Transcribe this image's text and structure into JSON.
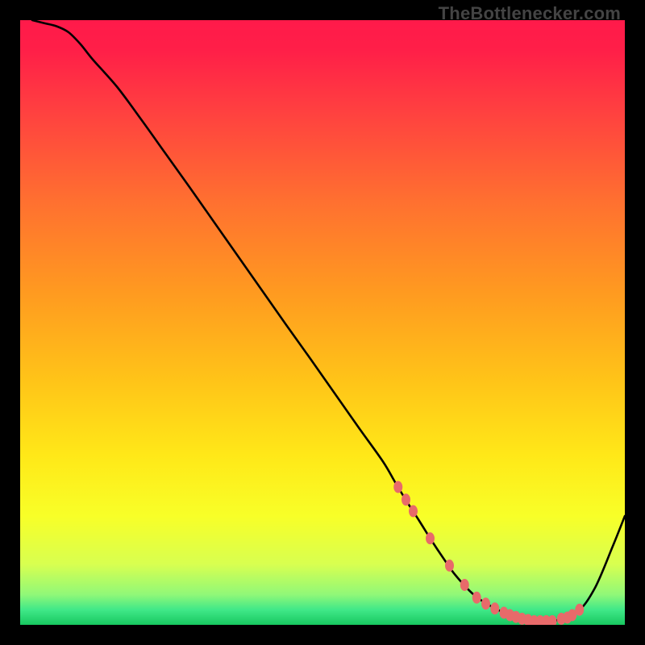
{
  "attribution": "TheBottlenecker.com",
  "chart_data": {
    "type": "line",
    "title": "",
    "xlabel": "",
    "ylabel": "",
    "xlim": [
      0,
      100
    ],
    "ylim": [
      0,
      100
    ],
    "background_gradient": {
      "stops": [
        {
          "offset": 0.0,
          "color": "#ff1a4a"
        },
        {
          "offset": 0.05,
          "color": "#ff1f48"
        },
        {
          "offset": 0.15,
          "color": "#ff4040"
        },
        {
          "offset": 0.3,
          "color": "#ff7030"
        },
        {
          "offset": 0.45,
          "color": "#ff9a20"
        },
        {
          "offset": 0.6,
          "color": "#ffc518"
        },
        {
          "offset": 0.72,
          "color": "#ffe818"
        },
        {
          "offset": 0.82,
          "color": "#f8ff28"
        },
        {
          "offset": 0.9,
          "color": "#d8ff50"
        },
        {
          "offset": 0.95,
          "color": "#90f878"
        },
        {
          "offset": 0.975,
          "color": "#40e888"
        },
        {
          "offset": 1.0,
          "color": "#18c860"
        }
      ]
    },
    "series": [
      {
        "name": "bottleneck-curve",
        "x": [
          2,
          4,
          6,
          8,
          10,
          12,
          16,
          20,
          24,
          28,
          32,
          36,
          40,
          44,
          48,
          52,
          56,
          60,
          62,
          64,
          66,
          68,
          70,
          72,
          75,
          78,
          82,
          85,
          88,
          92,
          95,
          98,
          100
        ],
        "y": [
          100,
          99.5,
          99,
          98,
          96,
          93.5,
          89,
          83.6,
          78,
          72.4,
          66.7,
          61,
          55.3,
          49.6,
          44,
          38.3,
          32.6,
          27,
          23.6,
          20.3,
          17.2,
          14,
          11,
          8.2,
          5,
          3.0,
          1.2,
          0.6,
          0.6,
          2.0,
          6.0,
          13.0,
          18.0
        ]
      }
    ],
    "markers": {
      "name": "highlight-dots",
      "color": "#e86a6a",
      "points": [
        {
          "x": 62.5,
          "y": 22.8
        },
        {
          "x": 63.8,
          "y": 20.7
        },
        {
          "x": 65.0,
          "y": 18.8
        },
        {
          "x": 67.8,
          "y": 14.3
        },
        {
          "x": 71.0,
          "y": 9.8
        },
        {
          "x": 73.5,
          "y": 6.6
        },
        {
          "x": 75.5,
          "y": 4.5
        },
        {
          "x": 77.0,
          "y": 3.5
        },
        {
          "x": 78.5,
          "y": 2.7
        },
        {
          "x": 80.0,
          "y": 2.0
        },
        {
          "x": 81.0,
          "y": 1.6
        },
        {
          "x": 82.0,
          "y": 1.3
        },
        {
          "x": 83.0,
          "y": 1.0
        },
        {
          "x": 84.0,
          "y": 0.8
        },
        {
          "x": 85.0,
          "y": 0.6
        },
        {
          "x": 86.0,
          "y": 0.6
        },
        {
          "x": 87.0,
          "y": 0.6
        },
        {
          "x": 88.0,
          "y": 0.6
        },
        {
          "x": 89.5,
          "y": 1.0
        },
        {
          "x": 90.5,
          "y": 1.2
        },
        {
          "x": 91.3,
          "y": 1.6
        },
        {
          "x": 92.5,
          "y": 2.5
        }
      ]
    }
  }
}
